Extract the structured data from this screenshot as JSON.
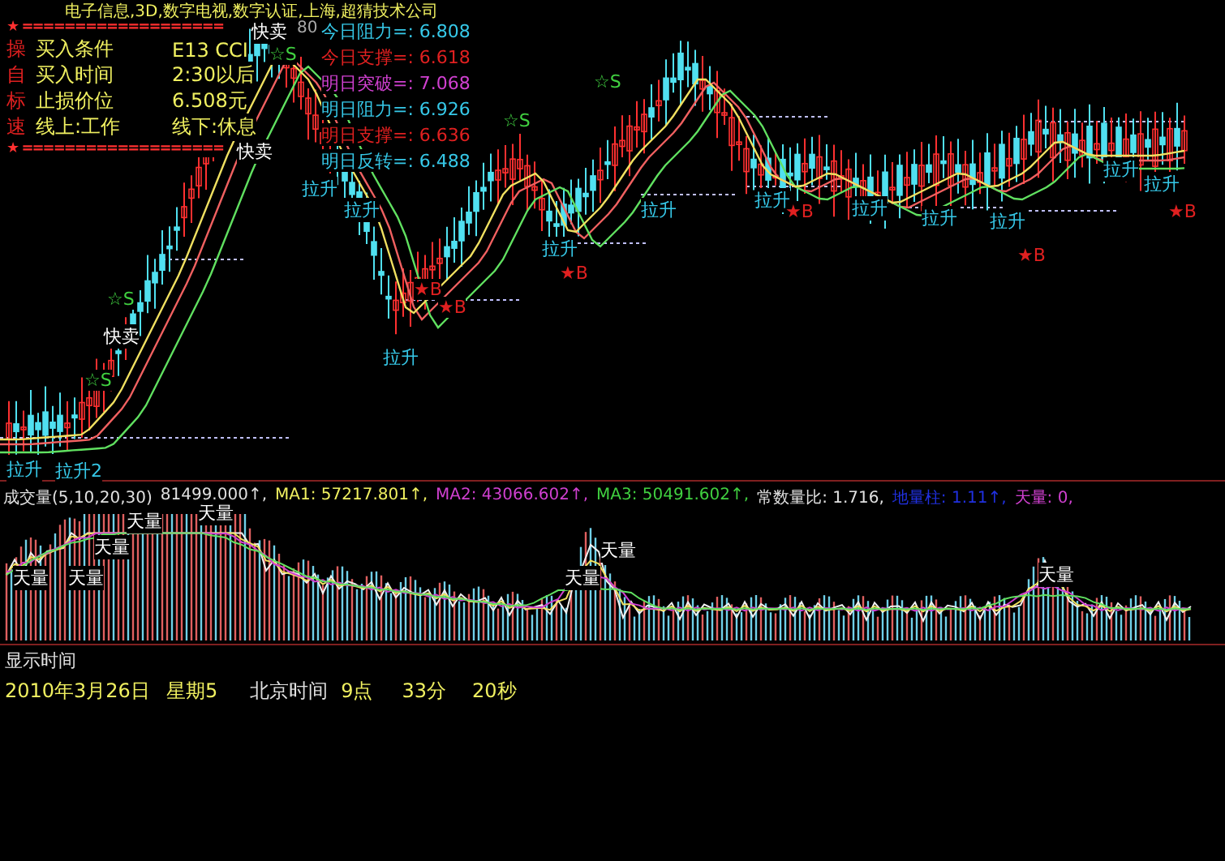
{
  "header": {
    "text": "电子信息,3D,数字电视,数字认证,上海,超猜技术公司"
  },
  "legend": {
    "top_rule": "★ ===================",
    "bottom_rule": "★ ===================",
    "rows": [
      {
        "tag": "操",
        "label": "买入条件",
        "value": "E13 CCI"
      },
      {
        "tag": "自",
        "label": "买入时间",
        "value": "2:30以后"
      },
      {
        "tag": "标",
        "label": "止损价位",
        "value": "6.508元"
      },
      {
        "tag": "速",
        "label": "线上:工作",
        "value": "线下:休息"
      }
    ]
  },
  "pivots": [
    {
      "label": "今日阻力=:",
      "value": "6.808",
      "color": "#36c8e8"
    },
    {
      "label": "今日支撑=:",
      "value": "6.618",
      "color": "#e02020"
    },
    {
      "label": "明日突破=:",
      "value": "7.068",
      "color": "#d040d0"
    },
    {
      "label": "明日阻力=:",
      "value": "6.926",
      "color": "#36c8e8"
    },
    {
      "label": "明日支撑=:",
      "value": "6.636",
      "color": "#e02020"
    },
    {
      "label": "明日反转=:",
      "value": "6.488",
      "color": "#36c8e8"
    }
  ],
  "price_label": "80",
  "markers": [
    {
      "kind": "sell",
      "text": "快卖"
    },
    {
      "kind": "sell",
      "text": "快卖"
    },
    {
      "kind": "sell",
      "text": "快卖"
    },
    {
      "kind": "star_s",
      "text": "☆S"
    },
    {
      "kind": "star_s",
      "text": "☆S"
    },
    {
      "kind": "star_s",
      "text": "☆S"
    },
    {
      "kind": "star_s",
      "text": "☆S"
    },
    {
      "kind": "star_s",
      "text": "☆S"
    },
    {
      "kind": "up",
      "text": "拉升"
    },
    {
      "kind": "up",
      "text": "拉升"
    },
    {
      "kind": "up",
      "text": "拉升"
    },
    {
      "kind": "up",
      "text": "拉升"
    },
    {
      "kind": "up",
      "text": "拉升"
    },
    {
      "kind": "up",
      "text": "拉升"
    },
    {
      "kind": "up",
      "text": "拉升"
    },
    {
      "kind": "up",
      "text": "拉升"
    },
    {
      "kind": "up",
      "text": "拉升"
    },
    {
      "kind": "up",
      "text": "拉升"
    },
    {
      "kind": "up",
      "text": "拉升"
    },
    {
      "kind": "up",
      "text": "拉升2"
    },
    {
      "kind": "up",
      "text": "拉升"
    },
    {
      "kind": "star_b",
      "text": "★B"
    },
    {
      "kind": "star_b",
      "text": "★B"
    },
    {
      "kind": "star_b",
      "text": "★B"
    },
    {
      "kind": "star_b",
      "text": "★B"
    },
    {
      "kind": "star_b",
      "text": "★B"
    },
    {
      "kind": "star_b",
      "text": "★B"
    }
  ],
  "volume": {
    "segments": [
      {
        "text": "成交量(5,10,20,30)",
        "color": "#e0e0e0"
      },
      {
        "text": "81499.000↑,",
        "color": "#e0e0e0"
      },
      {
        "text": "MA1: 57217.801↑,",
        "color": "#f0f060"
      },
      {
        "text": "MA2: 43066.602↑,",
        "color": "#d040d0"
      },
      {
        "text": "MA3: 50491.602↑,",
        "color": "#40d040"
      },
      {
        "text": "常数量比: 1.716,",
        "color": "#e0e0e0"
      },
      {
        "text": "地量柱: 1.11↑,",
        "color": "#2030e0"
      },
      {
        "text": "天量: 0,",
        "color": "#d040d0"
      }
    ],
    "peaks": [
      "天量",
      "天量",
      "天量",
      "天量",
      "天量",
      "天量",
      "天量",
      "天量"
    ]
  },
  "time": {
    "title": "显示时间",
    "parts": [
      {
        "text": "2010年3月26日",
        "color": "#f0f060"
      },
      {
        "text": "星期5",
        "color": "#f0f060"
      },
      {
        "text": "北京时间",
        "color": "#e0e0e0"
      },
      {
        "text": "9点",
        "color": "#f0f060"
      },
      {
        "text": "33分",
        "color": "#f0f060"
      },
      {
        "text": "20秒",
        "color": "#f0f060"
      }
    ]
  }
}
